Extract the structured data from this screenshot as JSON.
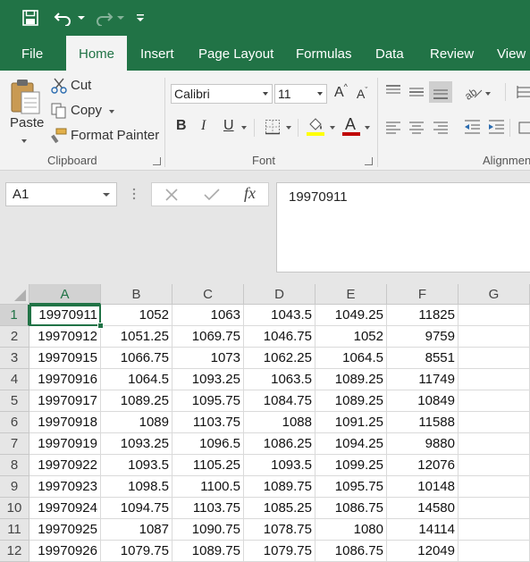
{
  "colors": {
    "accent": "#217346",
    "ribbon_bg": "#f3f3f3",
    "font_color_bar": "#c00000",
    "highlight_bar": "#ffff00"
  },
  "quick_access": {
    "save_icon": "save-icon",
    "undo_icon": "undo-icon",
    "redo_icon": "redo-icon",
    "customize_icon": "customize-icon"
  },
  "tabs": [
    "File",
    "Home",
    "Insert",
    "Page Layout",
    "Formulas",
    "Data",
    "Review",
    "View"
  ],
  "active_tab": "Home",
  "clipboard": {
    "paste_label": "Paste",
    "cut_label": "Cut",
    "copy_label": "Copy",
    "format_painter_label": "Format Painter",
    "group_label": "Clipboard"
  },
  "font": {
    "family": "Calibri",
    "size": "11",
    "bold_label": "B",
    "italic_label": "I",
    "underline_label": "U",
    "font_color_label": "A",
    "grow_label": "A",
    "shrink_label": "A",
    "group_label": "Font"
  },
  "alignment": {
    "group_label": "Alignment"
  },
  "formula_bar": {
    "name_box": "A1",
    "fx_label": "fx",
    "value": "19970911"
  },
  "grid": {
    "columns": [
      "A",
      "B",
      "C",
      "D",
      "E",
      "F",
      "G"
    ],
    "active_cell": "A1",
    "rows": [
      {
        "num": "1",
        "cells": [
          "19970911",
          "1052",
          "1063",
          "1043.5",
          "1049.25",
          "11825",
          ""
        ]
      },
      {
        "num": "2",
        "cells": [
          "19970912",
          "1051.25",
          "1069.75",
          "1046.75",
          "1052",
          "9759",
          ""
        ]
      },
      {
        "num": "3",
        "cells": [
          "19970915",
          "1066.75",
          "1073",
          "1062.25",
          "1064.5",
          "8551",
          ""
        ]
      },
      {
        "num": "4",
        "cells": [
          "19970916",
          "1064.5",
          "1093.25",
          "1063.5",
          "1089.25",
          "11749",
          ""
        ]
      },
      {
        "num": "5",
        "cells": [
          "19970917",
          "1089.25",
          "1095.75",
          "1084.75",
          "1089.25",
          "10849",
          ""
        ]
      },
      {
        "num": "6",
        "cells": [
          "19970918",
          "1089",
          "1103.75",
          "1088",
          "1091.25",
          "11588",
          ""
        ]
      },
      {
        "num": "7",
        "cells": [
          "19970919",
          "1093.25",
          "1096.5",
          "1086.25",
          "1094.25",
          "9880",
          ""
        ]
      },
      {
        "num": "8",
        "cells": [
          "19970922",
          "1093.5",
          "1105.25",
          "1093.5",
          "1099.25",
          "12076",
          ""
        ]
      },
      {
        "num": "9",
        "cells": [
          "19970923",
          "1098.5",
          "1100.5",
          "1089.75",
          "1095.75",
          "10148",
          ""
        ]
      },
      {
        "num": "10",
        "cells": [
          "19970924",
          "1094.75",
          "1103.75",
          "1085.25",
          "1086.75",
          "14580",
          ""
        ]
      },
      {
        "num": "11",
        "cells": [
          "19970925",
          "1087",
          "1090.75",
          "1078.75",
          "1080",
          "14114",
          ""
        ]
      },
      {
        "num": "12",
        "cells": [
          "19970926",
          "1079.75",
          "1089.75",
          "1079.75",
          "1086.75",
          "12049",
          ""
        ]
      }
    ]
  }
}
